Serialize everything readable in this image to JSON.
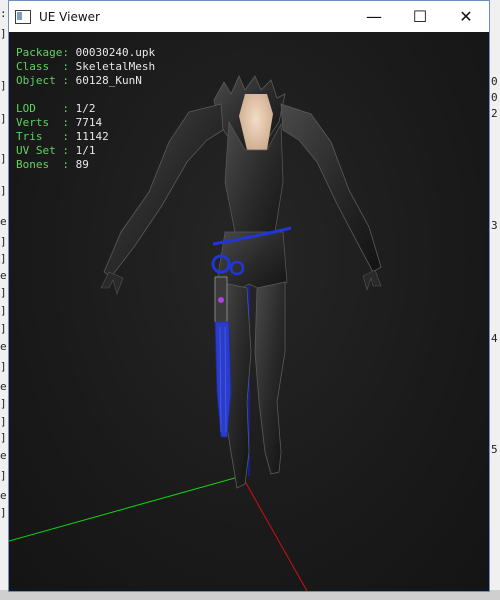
{
  "window": {
    "title": "UE Viewer",
    "minimize_glyph": "—",
    "maximize_glyph": "☐",
    "close_glyph": "✕"
  },
  "info_block_1": [
    {
      "key": "Package:",
      "value": "00030240.upk"
    },
    {
      "key": "Class  :",
      "value": "SkeletalMesh"
    },
    {
      "key": "Object :",
      "value": "60128_KunN"
    }
  ],
  "info_block_2": [
    {
      "key": "LOD    :",
      "value": "1/2"
    },
    {
      "key": "Verts  :",
      "value": "7714"
    },
    {
      "key": "Tris   :",
      "value": "11142"
    },
    {
      "key": "UV Set :",
      "value": "1/1"
    },
    {
      "key": "Bones  :",
      "value": "89"
    }
  ],
  "background": {
    "right_digits": [
      "0",
      "0",
      "2",
      "3",
      "4",
      "5"
    ]
  },
  "colors": {
    "label": "#5fd35f",
    "value": "#e8e8e8",
    "axis_x": "#d01010",
    "axis_y": "#10d010",
    "axis_z": "#1020e0",
    "accent_blue": "#2036d8"
  }
}
